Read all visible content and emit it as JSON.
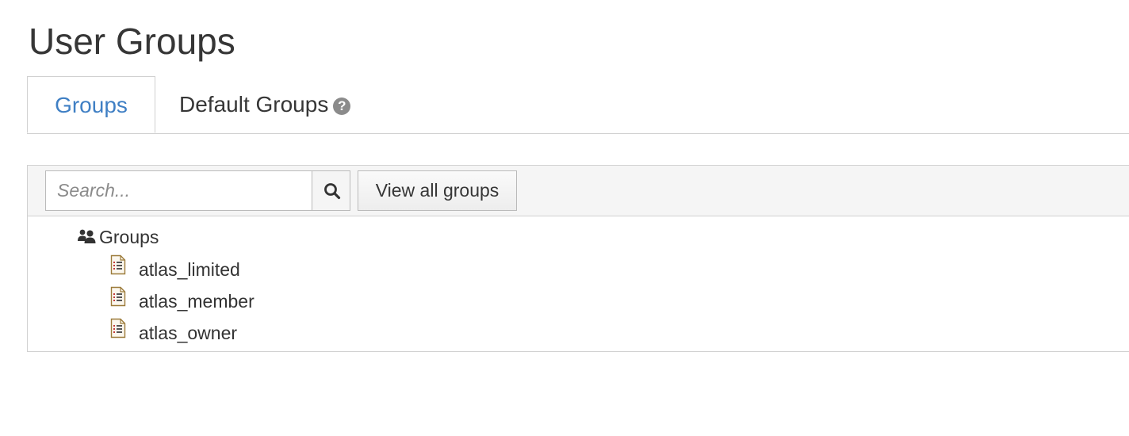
{
  "page": {
    "title": "User Groups"
  },
  "tabs": {
    "groups_label": "Groups",
    "default_groups_label": "Default Groups",
    "help_glyph": "?"
  },
  "toolbar": {
    "search_placeholder": "Search...",
    "search_value": "",
    "view_all_label": "View all groups"
  },
  "tree": {
    "root_label": "Groups",
    "root_icon": "users-icon",
    "items": [
      {
        "label": "atlas_limited",
        "icon": "document-icon"
      },
      {
        "label": "atlas_member",
        "icon": "document-icon"
      },
      {
        "label": "atlas_owner",
        "icon": "document-icon"
      }
    ]
  },
  "colors": {
    "accent": "#3f7fc4",
    "border": "#d1d1d1",
    "toolbar_bg": "#f5f5f5",
    "text": "#363636"
  }
}
